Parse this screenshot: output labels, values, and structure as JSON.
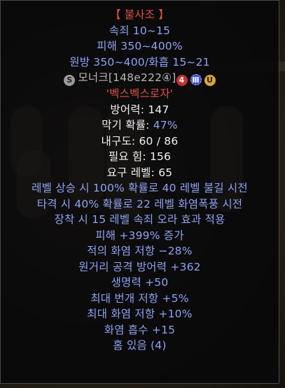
{
  "item": {
    "name": "【 불사조 】",
    "stat_lines_top": [
      "속죄 10~15",
      "피해 350~400%",
      "원방 350~400/화흡 15~21"
    ],
    "socket_line": {
      "prefix": "모너크[148e222④]",
      "icons": [
        "silver-s-icon",
        "red-four-icon",
        "blue-three-icon",
        "gold-u-icon"
      ],
      "icon_glyphs": {
        "s": "S",
        "four": "4",
        "three": "Ⅲ",
        "u": "U"
      }
    },
    "base_type": "'벡스벡스로자'",
    "defense": {
      "label": "방어력:",
      "value": "147"
    },
    "block": {
      "label": "막기 확률:",
      "value": "47%"
    },
    "durability": {
      "label": "내구도:",
      "value": "60 / 86"
    },
    "req_str": {
      "label": "필요 힘:",
      "value": "156"
    },
    "req_level": {
      "label": "요구 레벨:",
      "value": "65"
    },
    "magic_lines": [
      "레벨 상승 시 100% 확률로 40 레벨 불길 시전",
      "타격 시 40% 확률로 22 레벨 화염폭풍 시전",
      "장착 시 15 레벨 속죄 오라 효과 적용",
      "피해 +399% 증가",
      "적의 화염 저항 −28%",
      "원거리 공격 방어력 +362",
      "생명력 +50",
      "최대 번개 저항 +5%",
      "최대 화염 저항 +10%",
      "화염 흡수 +15",
      "홈 있음 (4)"
    ]
  },
  "colors": {
    "unique_name": "#e05048",
    "magic_blue": "#8da3f2",
    "white": "#f2f2f2"
  }
}
